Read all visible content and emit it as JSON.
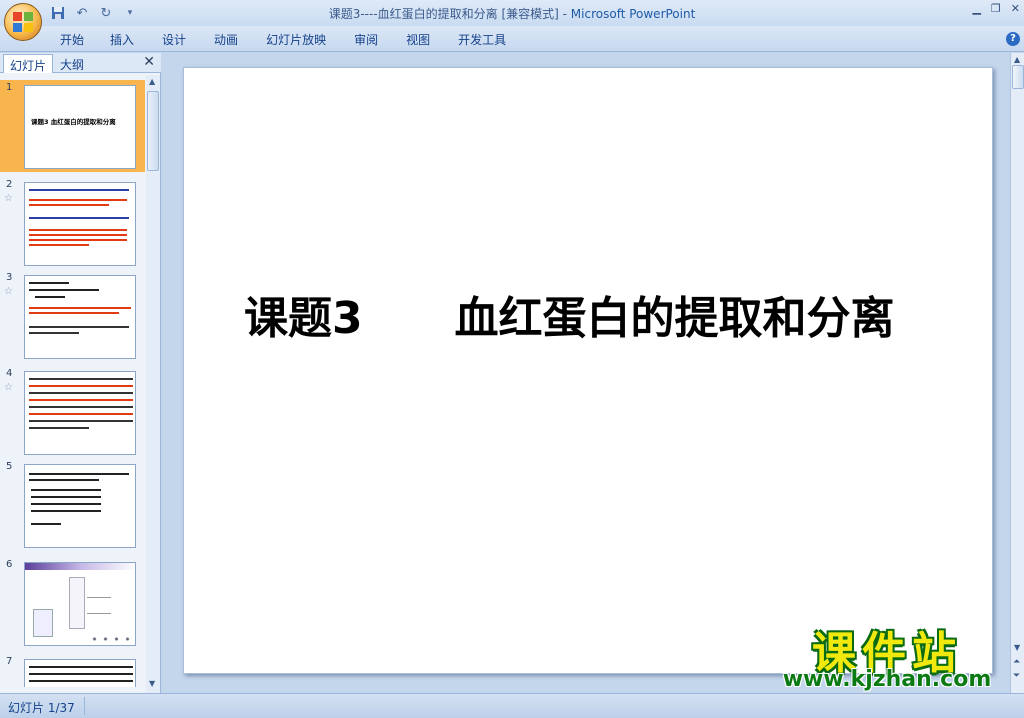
{
  "window": {
    "title_prefix": "课题3----血红蛋白的提取和分离 [兼容模式] - ",
    "app_name": "Microsoft PowerPoint"
  },
  "menu": [
    "开始",
    "插入",
    "设计",
    "动画",
    "幻灯片放映",
    "审阅",
    "视图",
    "开发工具"
  ],
  "left_pane": {
    "tabs": [
      "幻灯片",
      "大纲"
    ],
    "thumbnails": [
      {
        "number": "1",
        "selected": true,
        "title": "课题3     血红蛋白的提取和分离"
      },
      {
        "number": "2",
        "selected": false,
        "title": ""
      },
      {
        "number": "3",
        "selected": false,
        "title": ""
      },
      {
        "number": "4",
        "selected": false,
        "title": ""
      },
      {
        "number": "5",
        "selected": false,
        "title": ""
      },
      {
        "number": "6",
        "selected": false,
        "title": ""
      },
      {
        "number": "7",
        "selected": false,
        "title": ""
      }
    ]
  },
  "slide": {
    "title": "课题3      血红蛋白的提取和分离"
  },
  "status": {
    "slide_indicator": "幻灯片 1/37"
  },
  "watermark": {
    "title": "课件站",
    "url": "www.kjzhan.com"
  },
  "colors": {
    "ribbon_bg": "#c7d8ef",
    "selected_thumb": "#f8b54e",
    "slide_bg": "#ffffff",
    "watermark_yellow": "#f1e80d",
    "watermark_green": "#0c7a12"
  }
}
